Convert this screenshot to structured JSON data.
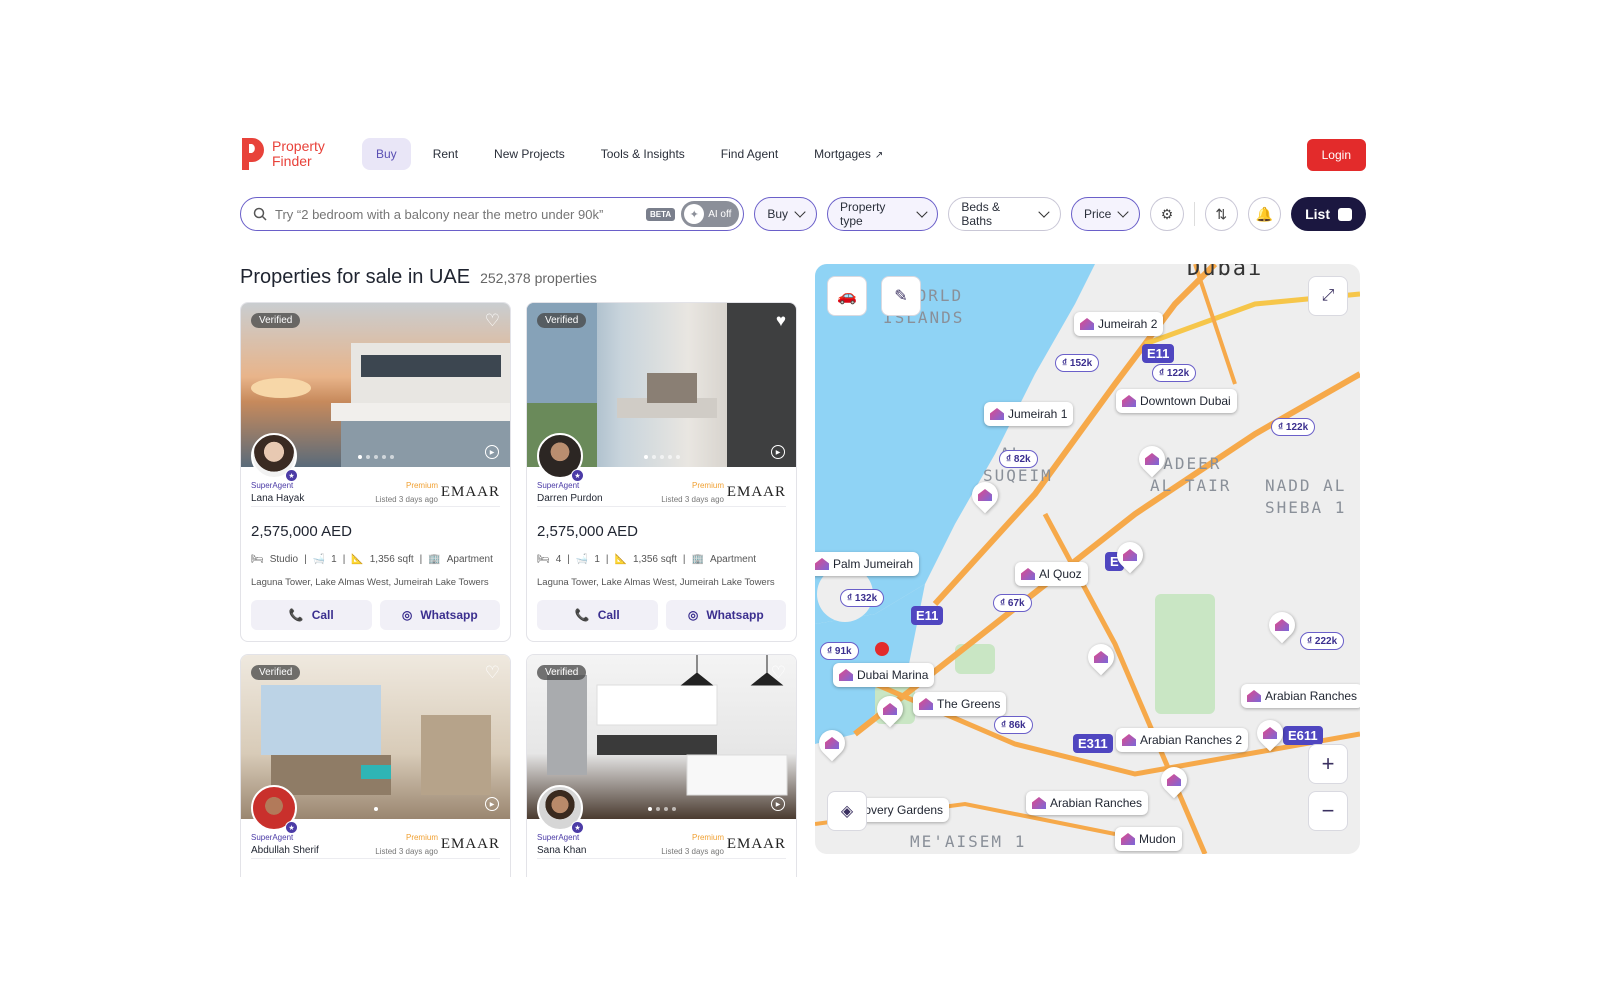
{
  "nav": {
    "logo_line1": "Property",
    "logo_line2": "Finder",
    "items": [
      "Buy",
      "Rent",
      "New Projects",
      "Tools & Insights",
      "Find Agent",
      "Mortgages"
    ],
    "login": "Login"
  },
  "search": {
    "placeholder": "Try “2 bedroom with a balcony near the metro under 90k”",
    "beta": "BETA",
    "ai": "AI off"
  },
  "filters": {
    "buy": "Buy",
    "property_type": "Property type",
    "beds_baths": "Beds & Baths",
    "price": "Price",
    "list": "List"
  },
  "heading": {
    "title": "Properties for sale in UAE",
    "count": "252,378 properties"
  },
  "cards": [
    {
      "verified": "Verified",
      "agent_tag": "SuperAgent",
      "agent": "Lana Hayak",
      "premium": "Premium",
      "listed": "Listed 3 days ago",
      "brand": "EMAAR",
      "price": "2,575,000 AED",
      "beds": "Studio",
      "baths": "1",
      "area": "1,356 sqft",
      "type": "Apartment",
      "address": "Laguna Tower, Lake Almas West, Jumeirah Lake Towers",
      "call": "Call",
      "whatsapp": "Whatsapp"
    },
    {
      "verified": "Verified",
      "agent_tag": "SuperAgent",
      "agent": "Darren Purdon",
      "premium": "Premium",
      "listed": "Listed 3 days ago",
      "brand": "EMAAR",
      "price": "2,575,000 AED",
      "beds": "4",
      "baths": "1",
      "area": "1,356 sqft",
      "type": "Apartment",
      "address": "Laguna Tower, Lake Almas West, Jumeirah Lake Towers",
      "call": "Call",
      "whatsapp": "Whatsapp"
    },
    {
      "verified": "Verified",
      "agent_tag": "SuperAgent",
      "agent": "Abdullah Sherif",
      "premium": "Premium",
      "listed": "Listed 3 days ago",
      "brand": "EMAAR"
    },
    {
      "verified": "Verified",
      "agent_tag": "SuperAgent",
      "agent": "Sana Khan",
      "premium": "Premium",
      "listed": "Listed 3 days ago",
      "brand": "EMAAR"
    }
  ],
  "map": {
    "locations": [
      "Jumeirah 2",
      "Downtown Dubai",
      "Jumeirah 1",
      "Palm Jumeirah",
      "Al Quoz",
      "Dubai Marina",
      "The Greens",
      "Arabian Ranches",
      "Arabian Ranches 2",
      "Arabian Ranches",
      "Mudon"
    ],
    "prices": [
      "₫ 152k",
      "₫ 122k",
      "₫ 122k",
      "₫ 82k",
      "₫ 132k",
      "₫ 67k",
      "₫ 91k",
      "₫ 86k",
      "₫ 222k"
    ],
    "areas": [
      "WORLD",
      "ISLANDS",
      "AL",
      "SUQEIM",
      "GHADEER",
      "AL TAIR",
      "NADD AL",
      "SHEBA 1",
      "ME'AISEM 1",
      "Dubai"
    ],
    "roads": [
      "E11",
      "E11",
      "E311",
      "E611",
      "E"
    ],
    "gardens_partial": "Discovery Gardens"
  }
}
